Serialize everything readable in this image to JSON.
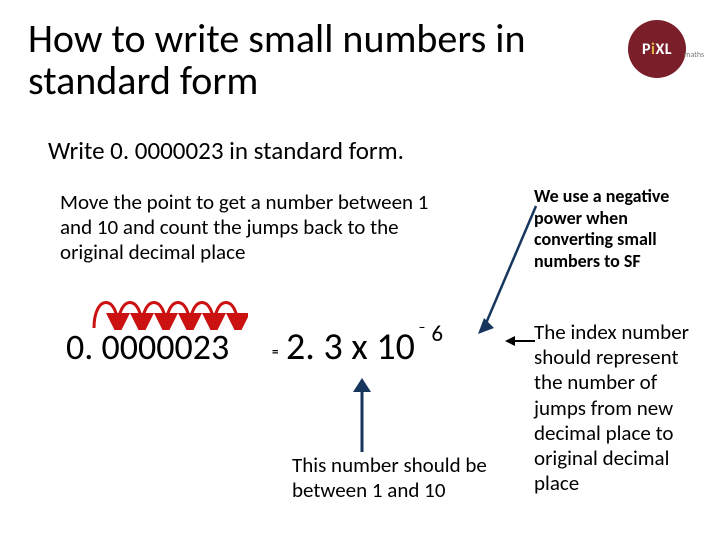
{
  "title": "How to write small numbers in standard form",
  "logo": {
    "brand": "PiXL",
    "sub": "maths"
  },
  "question": "Write 0. 0000023 in standard form.",
  "instruction": "Move the point to get a number between 1 and 10 and count the jumps back to the original decimal place",
  "big_number": "0. 0000023",
  "equals": "=",
  "result_base": "2. 3 x 10",
  "result_exp": "⁻ 6",
  "lower_note": "This number should be between 1 and 10",
  "side_note_1": "We use a negative power when converting small numbers to SF",
  "side_note_2": "The index number should represent the number of jumps from new decimal place to original decimal place"
}
